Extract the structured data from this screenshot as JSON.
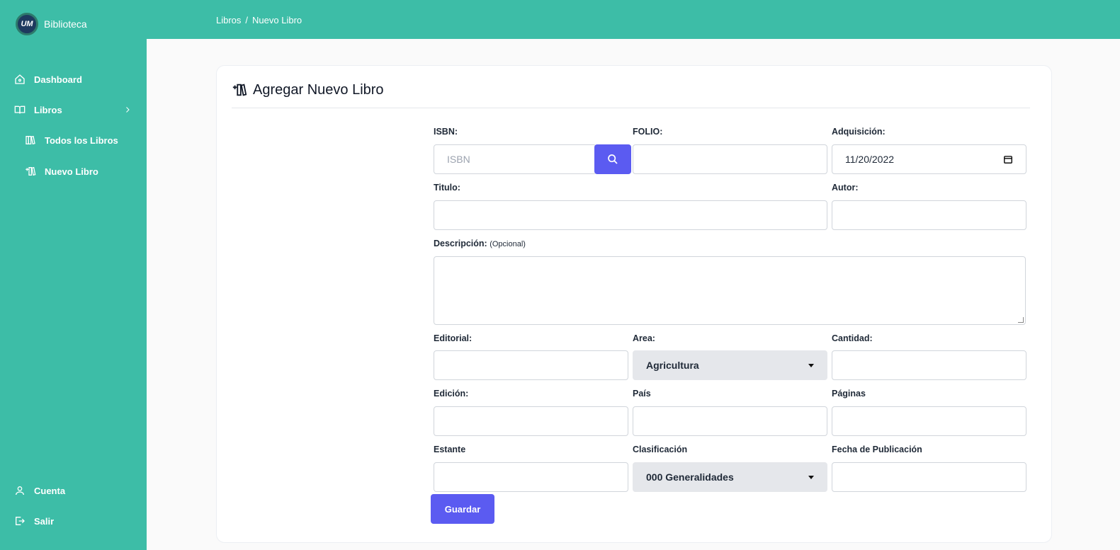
{
  "brand": {
    "name": "Biblioteca",
    "logo_text": "UM"
  },
  "sidebar": {
    "items": [
      {
        "label": "Dashboard"
      },
      {
        "label": "Libros"
      },
      {
        "label": "Todos los Libros"
      },
      {
        "label": "Nuevo Libro"
      },
      {
        "label": "Cuenta"
      },
      {
        "label": "Salir"
      }
    ]
  },
  "breadcrumb": {
    "parent": "Libros",
    "separator": "/",
    "current": "Nuevo Libro"
  },
  "form": {
    "title": "Agregar Nuevo Libro",
    "isbn_label": "ISBN:",
    "isbn_placeholder": "ISBN",
    "folio_label": "FOLIO:",
    "adquisicion_label": "Adquisición:",
    "adquisicion_value": "11/20/2022",
    "titulo_label": "Titulo:",
    "autor_label": "Autor:",
    "descripcion_label": "Descripción:",
    "descripcion_note": "(Opcional)",
    "editorial_label": "Editorial:",
    "area_label": "Area:",
    "area_value": "Agricultura",
    "cantidad_label": "Cantidad:",
    "edicion_label": "Edición:",
    "pais_label": "País",
    "paginas_label": "Páginas",
    "estante_label": "Estante",
    "clasificacion_label": "Clasificación",
    "clasificacion_value": "000 Generalidades",
    "fecha_pub_label": "Fecha de Publicación",
    "save_label": "Guardar"
  },
  "colors": {
    "primary": "#3dbda7",
    "accent": "#5b5bf1"
  }
}
